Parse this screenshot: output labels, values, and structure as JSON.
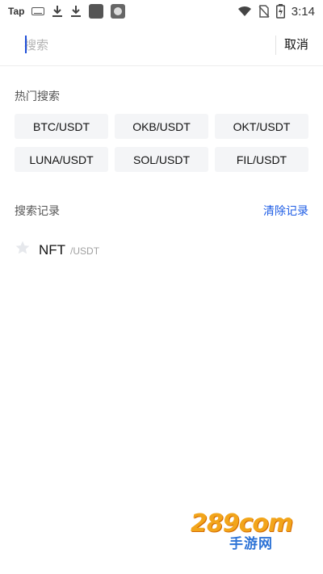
{
  "status_bar": {
    "left_text": "Tap",
    "time": "3:14",
    "icons": [
      "keyboard-icon",
      "download-icon",
      "download-icon",
      "app-icon",
      "app-icon",
      "wifi-icon",
      "no-sim-icon",
      "battery-charging-icon"
    ]
  },
  "search": {
    "placeholder": "搜索",
    "cancel_label": "取消"
  },
  "hot_search": {
    "title": "热门搜索",
    "items": [
      "BTC/USDT",
      "OKB/USDT",
      "OKT/USDT",
      "LUNA/USDT",
      "SOL/USDT",
      "FIL/USDT"
    ]
  },
  "history": {
    "title": "搜索记录",
    "clear_label": "清除记录",
    "items": [
      {
        "base": "NFT",
        "quote": "/USDT",
        "icon": "star-icon"
      }
    ]
  },
  "watermark": {
    "main": "289com",
    "sub": "手游网"
  },
  "colors": {
    "accent": "#1d5ce5",
    "chip_bg": "#f4f5f7",
    "placeholder": "#b3b3b3"
  }
}
